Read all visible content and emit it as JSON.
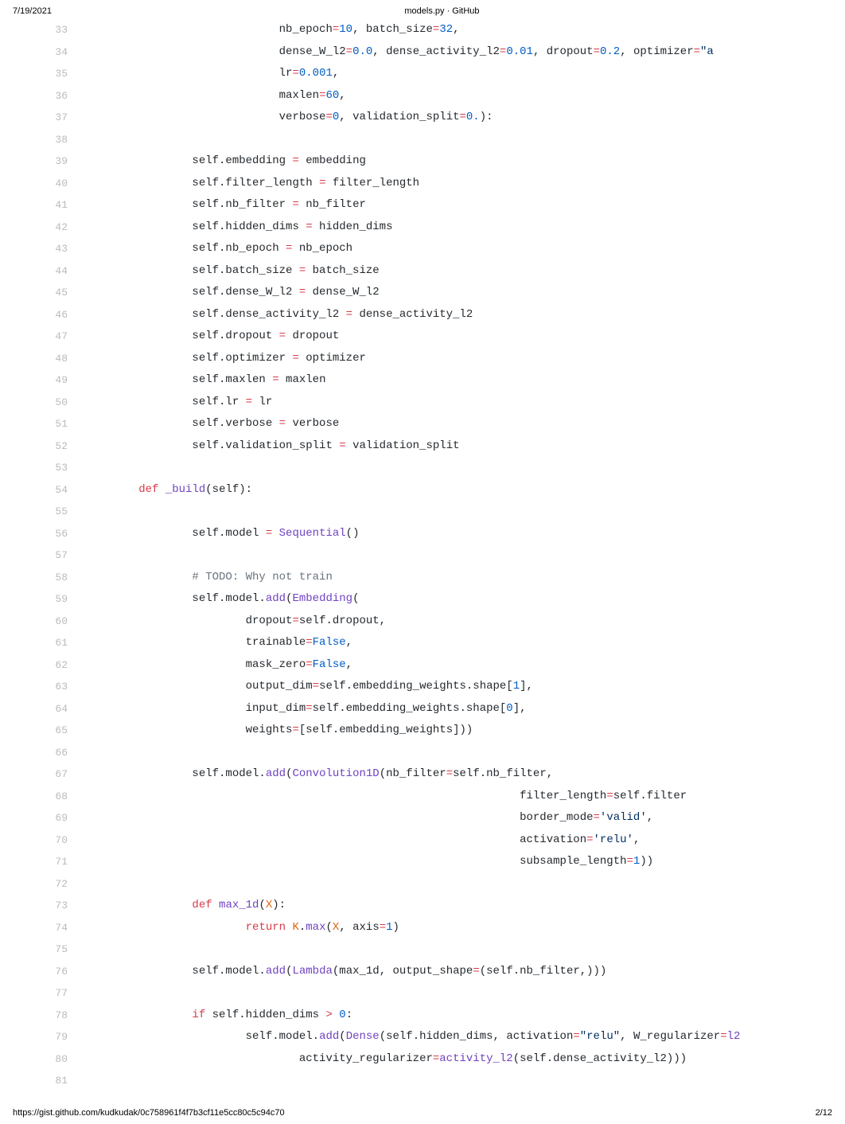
{
  "header": {
    "date": "7/19/2021",
    "title": "models.py · GitHub"
  },
  "footer": {
    "url": "https://gist.github.com/kudkudak/0c758961f4f7b3cf11e5cc80c5c94c70",
    "page": "2/12"
  },
  "lines": [
    {
      "n": 33,
      "t": [
        [
          "",
          "                             nb_epoch"
        ],
        [
          "op",
          "="
        ],
        [
          "num",
          "10"
        ],
        [
          "",
          ", batch_size"
        ],
        [
          "op",
          "="
        ],
        [
          "num",
          "32"
        ],
        [
          "",
          ","
        ]
      ]
    },
    {
      "n": 34,
      "t": [
        [
          "",
          "                             dense_W_l2"
        ],
        [
          "op",
          "="
        ],
        [
          "num",
          "0.0"
        ],
        [
          "",
          ", dense_activity_l2"
        ],
        [
          "op",
          "="
        ],
        [
          "num",
          "0.01"
        ],
        [
          "",
          ", dropout"
        ],
        [
          "op",
          "="
        ],
        [
          "num",
          "0.2"
        ],
        [
          "",
          ", optimizer"
        ],
        [
          "op",
          "="
        ],
        [
          "str",
          "\"a"
        ]
      ]
    },
    {
      "n": 35,
      "t": [
        [
          "",
          "                             lr"
        ],
        [
          "op",
          "="
        ],
        [
          "num",
          "0.001"
        ],
        [
          "",
          ","
        ]
      ]
    },
    {
      "n": 36,
      "t": [
        [
          "",
          "                             maxlen"
        ],
        [
          "op",
          "="
        ],
        [
          "num",
          "60"
        ],
        [
          "",
          ","
        ]
      ]
    },
    {
      "n": 37,
      "t": [
        [
          "",
          "                             verbose"
        ],
        [
          "op",
          "="
        ],
        [
          "num",
          "0"
        ],
        [
          "",
          ", validation_split"
        ],
        [
          "op",
          "="
        ],
        [
          "num",
          "0."
        ],
        [
          "",
          "):"
        ]
      ]
    },
    {
      "n": 38,
      "t": [
        [
          "",
          ""
        ]
      ]
    },
    {
      "n": 39,
      "t": [
        [
          "",
          "                self.embedding "
        ],
        [
          "op",
          "="
        ],
        [
          "",
          " embedding"
        ]
      ]
    },
    {
      "n": 40,
      "t": [
        [
          "",
          "                self.filter_length "
        ],
        [
          "op",
          "="
        ],
        [
          "",
          " filter_length"
        ]
      ]
    },
    {
      "n": 41,
      "t": [
        [
          "",
          "                self.nb_filter "
        ],
        [
          "op",
          "="
        ],
        [
          "",
          " nb_filter"
        ]
      ]
    },
    {
      "n": 42,
      "t": [
        [
          "",
          "                self.hidden_dims "
        ],
        [
          "op",
          "="
        ],
        [
          "",
          " hidden_dims"
        ]
      ]
    },
    {
      "n": 43,
      "t": [
        [
          "",
          "                self.nb_epoch "
        ],
        [
          "op",
          "="
        ],
        [
          "",
          " nb_epoch"
        ]
      ]
    },
    {
      "n": 44,
      "t": [
        [
          "",
          "                self.batch_size "
        ],
        [
          "op",
          "="
        ],
        [
          "",
          " batch_size"
        ]
      ]
    },
    {
      "n": 45,
      "t": [
        [
          "",
          "                self.dense_W_l2 "
        ],
        [
          "op",
          "="
        ],
        [
          "",
          " dense_W_l2"
        ]
      ]
    },
    {
      "n": 46,
      "t": [
        [
          "",
          "                self.dense_activity_l2 "
        ],
        [
          "op",
          "="
        ],
        [
          "",
          " dense_activity_l2"
        ]
      ]
    },
    {
      "n": 47,
      "t": [
        [
          "",
          "                self.dropout "
        ],
        [
          "op",
          "="
        ],
        [
          "",
          " dropout"
        ]
      ]
    },
    {
      "n": 48,
      "t": [
        [
          "",
          "                self.optimizer "
        ],
        [
          "op",
          "="
        ],
        [
          "",
          " optimizer"
        ]
      ]
    },
    {
      "n": 49,
      "t": [
        [
          "",
          "                self.maxlen "
        ],
        [
          "op",
          "="
        ],
        [
          "",
          " maxlen"
        ]
      ]
    },
    {
      "n": 50,
      "t": [
        [
          "",
          "                self.lr "
        ],
        [
          "op",
          "="
        ],
        [
          "",
          " lr"
        ]
      ]
    },
    {
      "n": 51,
      "t": [
        [
          "",
          "                self.verbose "
        ],
        [
          "op",
          "="
        ],
        [
          "",
          " verbose"
        ]
      ]
    },
    {
      "n": 52,
      "t": [
        [
          "",
          "                self.validation_split "
        ],
        [
          "op",
          "="
        ],
        [
          "",
          " validation_split"
        ]
      ]
    },
    {
      "n": 53,
      "t": [
        [
          "",
          ""
        ]
      ]
    },
    {
      "n": 54,
      "t": [
        [
          "",
          "        "
        ],
        [
          "kw",
          "def"
        ],
        [
          "",
          " "
        ],
        [
          "fn",
          "_build"
        ],
        [
          "",
          "(self):"
        ]
      ]
    },
    {
      "n": 55,
      "t": [
        [
          "",
          ""
        ]
      ]
    },
    {
      "n": 56,
      "t": [
        [
          "",
          "                self.model "
        ],
        [
          "op",
          "="
        ],
        [
          "",
          " "
        ],
        [
          "fn",
          "Sequential"
        ],
        [
          "",
          "()"
        ]
      ]
    },
    {
      "n": 57,
      "t": [
        [
          "",
          ""
        ]
      ]
    },
    {
      "n": 58,
      "t": [
        [
          "",
          "                "
        ],
        [
          "cmt",
          "# TODO: Why not train"
        ]
      ]
    },
    {
      "n": 59,
      "t": [
        [
          "",
          "                self.model."
        ],
        [
          "fn",
          "add"
        ],
        [
          "",
          "("
        ],
        [
          "fn",
          "Embedding"
        ],
        [
          "",
          "("
        ]
      ]
    },
    {
      "n": 60,
      "t": [
        [
          "",
          "                        dropout"
        ],
        [
          "op",
          "="
        ],
        [
          "",
          "self.dropout,"
        ]
      ]
    },
    {
      "n": 61,
      "t": [
        [
          "",
          "                        trainable"
        ],
        [
          "op",
          "="
        ],
        [
          "num",
          "False"
        ],
        [
          "",
          ","
        ]
      ]
    },
    {
      "n": 62,
      "t": [
        [
          "",
          "                        mask_zero"
        ],
        [
          "op",
          "="
        ],
        [
          "num",
          "False"
        ],
        [
          "",
          ","
        ]
      ]
    },
    {
      "n": 63,
      "t": [
        [
          "",
          "                        output_dim"
        ],
        [
          "op",
          "="
        ],
        [
          "",
          "self.embedding_weights.shape["
        ],
        [
          "num",
          "1"
        ],
        [
          "",
          "],"
        ]
      ]
    },
    {
      "n": 64,
      "t": [
        [
          "",
          "                        input_dim"
        ],
        [
          "op",
          "="
        ],
        [
          "",
          "self.embedding_weights.shape["
        ],
        [
          "num",
          "0"
        ],
        [
          "",
          "],"
        ]
      ]
    },
    {
      "n": 65,
      "t": [
        [
          "",
          "                        weights"
        ],
        [
          "op",
          "="
        ],
        [
          "",
          "[self.embedding_weights]))"
        ]
      ]
    },
    {
      "n": 66,
      "t": [
        [
          "",
          ""
        ]
      ]
    },
    {
      "n": 67,
      "t": [
        [
          "",
          "                self.model."
        ],
        [
          "fn",
          "add"
        ],
        [
          "",
          "("
        ],
        [
          "fn",
          "Convolution1D"
        ],
        [
          "",
          "(nb_filter"
        ],
        [
          "op",
          "="
        ],
        [
          "",
          "self.nb_filter,"
        ]
      ]
    },
    {
      "n": 68,
      "t": [
        [
          "",
          "                                                                 filter_length"
        ],
        [
          "op",
          "="
        ],
        [
          "",
          "self.filter"
        ]
      ]
    },
    {
      "n": 69,
      "t": [
        [
          "",
          "                                                                 border_mode"
        ],
        [
          "op",
          "="
        ],
        [
          "str",
          "'valid'"
        ],
        [
          "",
          ","
        ]
      ]
    },
    {
      "n": 70,
      "t": [
        [
          "",
          "                                                                 activation"
        ],
        [
          "op",
          "="
        ],
        [
          "str",
          "'relu'"
        ],
        [
          "",
          ","
        ]
      ]
    },
    {
      "n": 71,
      "t": [
        [
          "",
          "                                                                 subsample_length"
        ],
        [
          "op",
          "="
        ],
        [
          "num",
          "1"
        ],
        [
          "",
          "))"
        ]
      ]
    },
    {
      "n": 72,
      "t": [
        [
          "",
          ""
        ]
      ]
    },
    {
      "n": 73,
      "t": [
        [
          "",
          "                "
        ],
        [
          "kw",
          "def"
        ],
        [
          "",
          " "
        ],
        [
          "fn",
          "max_1d"
        ],
        [
          "",
          "("
        ],
        [
          "var",
          "X"
        ],
        [
          "",
          "):"
        ]
      ]
    },
    {
      "n": 74,
      "t": [
        [
          "",
          "                        "
        ],
        [
          "kw",
          "return"
        ],
        [
          "",
          " "
        ],
        [
          "var",
          "K"
        ],
        [
          "",
          "."
        ],
        [
          "fn",
          "max"
        ],
        [
          "",
          "("
        ],
        [
          "var",
          "X"
        ],
        [
          "",
          ", axis"
        ],
        [
          "op",
          "="
        ],
        [
          "num",
          "1"
        ],
        [
          "",
          ")"
        ]
      ]
    },
    {
      "n": 75,
      "t": [
        [
          "",
          ""
        ]
      ]
    },
    {
      "n": 76,
      "t": [
        [
          "",
          "                self.model."
        ],
        [
          "fn",
          "add"
        ],
        [
          "",
          "("
        ],
        [
          "fn",
          "Lambda"
        ],
        [
          "",
          "(max_1d, output_shape"
        ],
        [
          "op",
          "="
        ],
        [
          "",
          "(self.nb_filter,)))"
        ]
      ]
    },
    {
      "n": 77,
      "t": [
        [
          "",
          ""
        ]
      ]
    },
    {
      "n": 78,
      "t": [
        [
          "",
          "                "
        ],
        [
          "kw",
          "if"
        ],
        [
          "",
          " self.hidden_dims "
        ],
        [
          "op",
          ">"
        ],
        [
          "",
          " "
        ],
        [
          "num",
          "0"
        ],
        [
          "",
          ":"
        ]
      ]
    },
    {
      "n": 79,
      "t": [
        [
          "",
          "                        self.model."
        ],
        [
          "fn",
          "add"
        ],
        [
          "",
          "("
        ],
        [
          "fn",
          "Dense"
        ],
        [
          "",
          "(self.hidden_dims, activation"
        ],
        [
          "op",
          "="
        ],
        [
          "str",
          "\"relu\""
        ],
        [
          "",
          ", W_regularizer"
        ],
        [
          "op",
          "="
        ],
        [
          "fn",
          "l2"
        ]
      ]
    },
    {
      "n": 80,
      "t": [
        [
          "",
          "                                activity_regularizer"
        ],
        [
          "op",
          "="
        ],
        [
          "fn",
          "activity_l2"
        ],
        [
          "",
          "(self.dense_activity_l2)))"
        ]
      ]
    },
    {
      "n": 81,
      "t": [
        [
          "",
          ""
        ]
      ]
    }
  ]
}
